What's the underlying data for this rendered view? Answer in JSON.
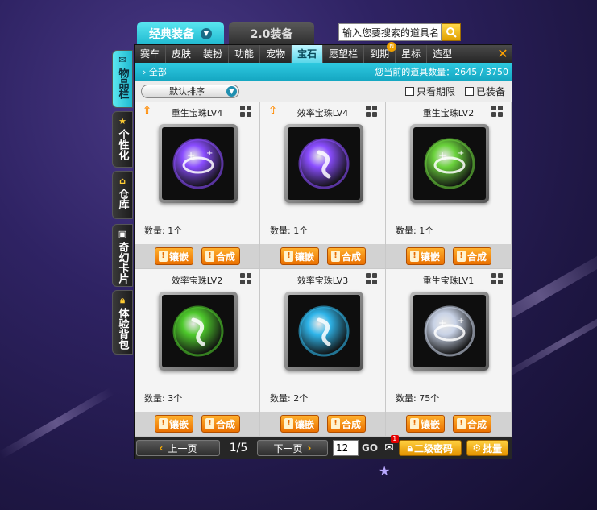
{
  "top_tabs": [
    {
      "label": "经典装备",
      "active": true
    },
    {
      "label": "2.0装备",
      "active": false
    }
  ],
  "search": {
    "value": "输入您要搜索的道具名"
  },
  "side_tabs": [
    {
      "label": "物品栏",
      "icon": "bag-icon",
      "active": true
    },
    {
      "label": "个性化",
      "icon": "star-icon",
      "active": false
    },
    {
      "label": "仓库",
      "icon": "house-icon",
      "active": false
    },
    {
      "label": "奇幻卡片",
      "icon": "card-icon",
      "active": false
    },
    {
      "label": "体验背包",
      "icon": "lock-icon",
      "active": false
    }
  ],
  "categories": [
    {
      "label": "赛车"
    },
    {
      "label": "皮肤"
    },
    {
      "label": "装扮"
    },
    {
      "label": "功能"
    },
    {
      "label": "宠物"
    },
    {
      "label": "宝石",
      "active": true
    },
    {
      "label": "愿望栏"
    },
    {
      "label": "到期",
      "badge": "N"
    },
    {
      "label": "星标"
    },
    {
      "label": "造型"
    }
  ],
  "close_symbol": "✕",
  "info_bar": {
    "filter_label": "全部",
    "count_text": "您当前的道具数量：2645 / 3750"
  },
  "filter": {
    "sort_label": "默认排序",
    "check_expiring": "只看期限",
    "check_equipped": "已装备"
  },
  "items": [
    {
      "name": "重生宝珠LV4",
      "qty": "数量: 1个",
      "upgrade": true,
      "gem_color": "#8a4dff",
      "glyph": "ring"
    },
    {
      "name": "效率宝珠LV4",
      "qty": "数量: 1个",
      "upgrade": true,
      "gem_color": "#8a4dff",
      "glyph": "swirl"
    },
    {
      "name": "重生宝珠LV2",
      "qty": "数量: 1个",
      "upgrade": false,
      "gem_color": "#6ad23c",
      "glyph": "ring"
    },
    {
      "name": "效率宝珠LV2",
      "qty": "数量: 3个",
      "upgrade": false,
      "gem_color": "#4ec92c",
      "glyph": "swirl"
    },
    {
      "name": "效率宝珠LV3",
      "qty": "数量: 2个",
      "upgrade": false,
      "gem_color": "#2fb5ea",
      "glyph": "swirl"
    },
    {
      "name": "重生宝珠LV1",
      "qty": "数量: 75个",
      "upgrade": false,
      "gem_color": "#c8d2e6",
      "glyph": "ring"
    }
  ],
  "item_buttons": {
    "embed": "镶嵌",
    "combine": "合成"
  },
  "footer": {
    "prev": "上一页",
    "page": "1/5",
    "next": "下一页",
    "page_input": "12",
    "go": "GO",
    "mail_badge": "1",
    "password": "二级密码",
    "batch": "批量"
  }
}
